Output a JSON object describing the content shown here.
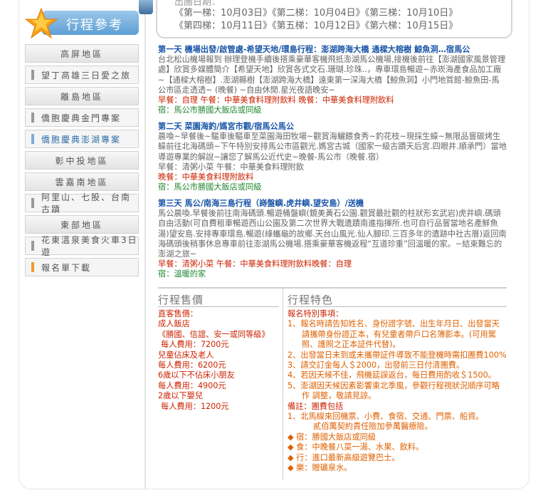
{
  "sidebar": {
    "title": "行程參考",
    "items": [
      {
        "label": "高屏地區",
        "style": "c"
      },
      {
        "label": "望丁高雄三日愛之旅",
        "style": "lm"
      },
      {
        "label": "離島地區",
        "style": "c"
      },
      {
        "label": "僑胞慶典金門專案",
        "style": "lm"
      },
      {
        "label": "僑胞慶典澎湖專案",
        "style": "lm blue"
      },
      {
        "label": "彰中投地區",
        "style": "c"
      },
      {
        "label": "雲嘉南地區",
        "style": "c"
      },
      {
        "label": "阿里山、七股、台南古蹟",
        "style": "lm"
      },
      {
        "label": "東部地區",
        "style": "c"
      },
      {
        "label": "花東溫泉美食火車3日遊",
        "style": "lm"
      },
      {
        "label": "報名單下載",
        "style": "lm orange"
      }
    ]
  },
  "dates": {
    "partial": "出團日期：",
    "line1": "《第一梯：10月03日》《第二梯：10月04日》《第三梯：10月10日》",
    "line2": "《第四梯：10月11日》《第五梯：10月12日》《第六梯：10月15日》"
  },
  "days": [
    {
      "title": "第一天 機場出發/啟管處-希望天地/環島行程：澎湖跨海大橋 通樑大榕樹 鯨魚洞…宿馬公",
      "body": "台北松山機場報到 辦理登機手續後搭乘豪華客機飛抵澎湖馬公機場,接機後前往【澎湖國家風景管理處】欣賞多媒體簡介【希望天地】欣賞各式文石.珊瑚.珍珠..，專車環島暢遊~赤崁海產食品加工廠~【通樑大榕樹】.澎湖縣樹【澎湖跨海大橋】遠東第一深海大橋【鯨魚洞】小門地質館-鯨魚田-馬公市區走透透~ (晚餐) ~自由休閒.星光夜語晚安~",
      "meal": "早餐：自理 午餐：中華美食料理附飲料 晚餐：中華美食料理附飲料",
      "stay": "宿：馬公市勝國大飯店或同級"
    },
    {
      "title": "第二天 菜園海釣/媽宮市觀/宿馬公馬公",
      "body": "晨喚~早餐後~驅車後驅車至菜園海田牧場~觀賞海鱺餵食秀~釣花枝~現採生蠔~無限品嘗碳烤生蠔前往北海碼頭~下午特別安排馬公市區觀光.媽宮古城（國家一級古蹟天后宮.四眼井.順承門）當地導遊專業的解說~讓您了解馬公近代史~晚餐-馬公市（晚餐.宿）",
      "meal1": "早餐：清粥小菜 午餐：中華美食料理附飲",
      "meal2": "晚餐：中華美食料理附飲料",
      "stay": "宿：馬公市勝國大飯店或同級"
    },
    {
      "title": "第三天 馬公/南海三島行程（嵵盤嶼.虎井嶼.望安島）/送機",
      "body": "馬公晨喚.早餐後前往南海碼頭.暢遊桶盤嶼(鏡美黃石公園.觀賞最壯觀的柱狀形玄武岩)虎井嶼.碼頭自由活動(可自費租車暢遊西山公園及第二次世界大戰遺蹟南進指揮所.也可自行品嘗當地名產鮮魚湯)望安島.安排專車環島.暢遊(綠蠵龜的故鄉.天台山風光.仙人腳印.三百多年的遺跡中社古厝)返回南海碼頭後稍事休息專車前往澎湖馬公機場.搭乘豪華客機返程“互道珍重”回溫暖的家。~結束難忘的澎湖之旅~",
      "meal": "早餐：清粥小菜 午餐：中華美食料理附飲料晚餐：自理",
      "stay": "宿：溫暖的家"
    }
  ],
  "price": {
    "title": "行程售價",
    "lines": [
      {
        "text": "直客售價：",
        "ind": false
      },
      {
        "text": "成人飯店",
        "ind": false
      },
      {
        "text": "《勝國、信誼、安一或同等級》",
        "ind": false
      },
      {
        "text": "每人費用：7200元",
        "ind": true
      },
      {
        "text": "兒童佔床及老人",
        "ind": false
      },
      {
        "text": "每人費用：6200元",
        "ind": false
      },
      {
        "text": "6歲以下不佔床小朋友",
        "ind": false
      },
      {
        "text": "每人費用：4900元",
        "ind": false
      },
      {
        "text": "2歲以下嬰兒",
        "ind": false
      },
      {
        "text": "每人費用：1200元",
        "ind": true
      }
    ]
  },
  "features": {
    "title": "行程特色",
    "lines": [
      {
        "text": "報名特別事項：",
        "cls": ""
      },
      {
        "text": "1、報名時請告知姓名、身份證字號、出生年月日、出發當天",
        "cls": "o"
      },
      {
        "text": "請攜帶身份證正本，有兒童者帶戶口名簿影本。(可用駕",
        "cls": "o ind"
      },
      {
        "text": "照、護照之正本証件代替)。",
        "cls": "o ind"
      },
      {
        "text": "2、出發當日未到或未攜帶証件導致不能登機時需扣團費100%",
        "cls": "o"
      },
      {
        "text": "3、請交訂金每人＄2000，出發前三日付清團費。",
        "cls": "o"
      },
      {
        "text": "4、若因天候不佳，飛機延誤返台，每日費用酌收＄1500。",
        "cls": "o"
      },
      {
        "text": "5、澎湖因天候因素影響東北季風，參觀行程視狀況順序可略",
        "cls": "o"
      },
      {
        "text": "作 調整，敬請見諒。",
        "cls": "o ind"
      },
      {
        "text": "備註：團費包括",
        "cls": ""
      },
      {
        "text": "1、北馬線來回機票、小費、食宿、交通、門票、船資。",
        "cls": "o"
      },
      {
        "text": "貳佰萬契約責任險加參萬醫療險。",
        "cls": "o ind2"
      },
      {
        "text": "◆ 宿：勝國大飯店或同級",
        "cls": "o"
      },
      {
        "text": "◆ 食：中晚餐八菜一湯、水果、飲料。",
        "cls": "o"
      },
      {
        "text": "◆ 行：進口最新高級遊覽巴士。",
        "cls": "o"
      },
      {
        "text": "◆ 樂：贈礦泉水。",
        "cls": "o"
      }
    ]
  }
}
